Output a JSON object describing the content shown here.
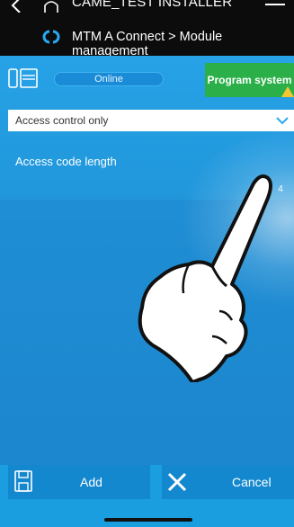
{
  "header": {
    "installer_title": "CAME_TEST INSTALLER",
    "breadcrumb": "MTM A Connect > Module management"
  },
  "status": {
    "label": "Online"
  },
  "toolbar": {
    "program_label": "Program system"
  },
  "form": {
    "access_select_value": "Access control only",
    "code_length_label": "Access code length",
    "code_length_value": "4"
  },
  "footer": {
    "add_label": "Add",
    "cancel_label": "Cancel"
  },
  "colors": {
    "header_bg": "#0c0c0c",
    "panel_blue": "#1f93d8",
    "program_green": "#2bb049",
    "button_blue": "#1488cf"
  },
  "icons": {
    "back": "chevron-left-icon",
    "home": "home-icon",
    "menu": "hamburger-menu-icon",
    "brand": "came-connect-logo-icon",
    "device": "intercom-device-icon",
    "warning": "warning-triangle-icon",
    "chevron": "chevron-down-icon",
    "gesture": "tap-hand-icon",
    "save": "save-floppy-icon",
    "close": "close-x-icon"
  }
}
